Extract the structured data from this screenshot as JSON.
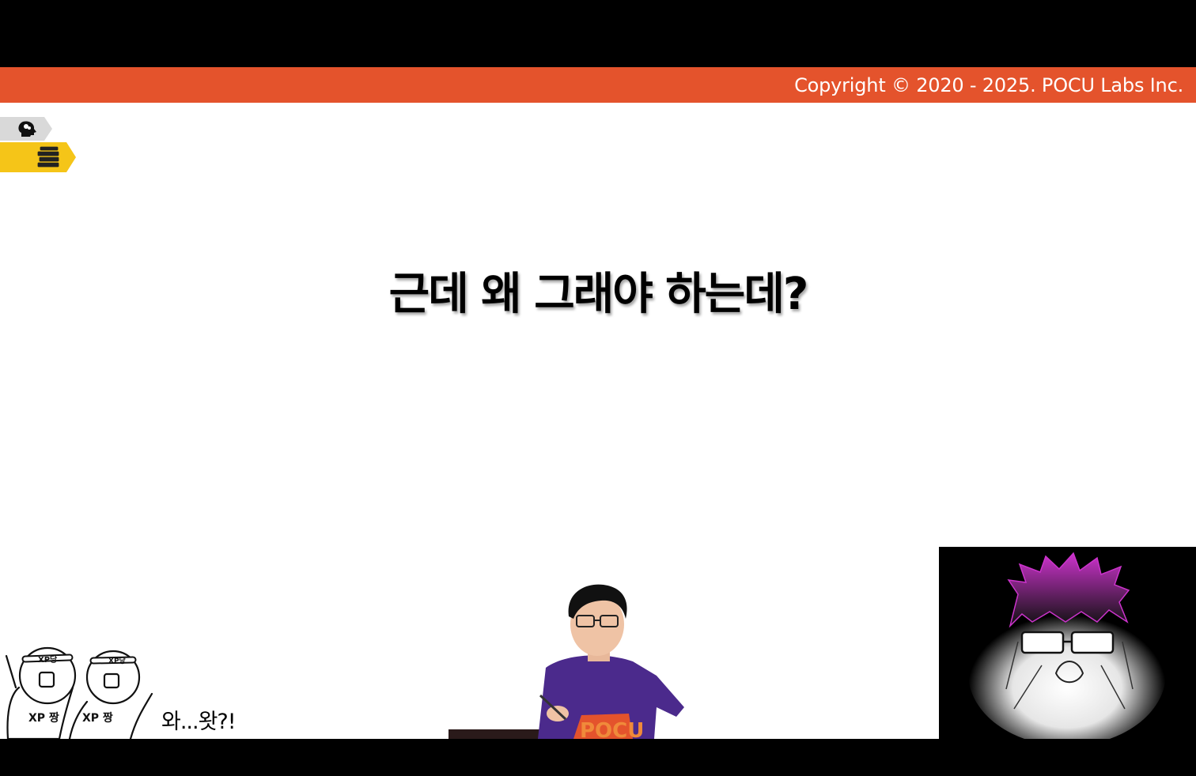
{
  "banner": {
    "copyright": "Copyright © 2020 - 2025. POCU Labs Inc.",
    "color": "#e4532c"
  },
  "side_tags": [
    {
      "icon": "brain-head-icon",
      "color": "#d9d9d9"
    },
    {
      "icon": "book-stack-icon",
      "color": "#f5c518"
    }
  ],
  "slide": {
    "title": "근데 왜 그래야 하는데?"
  },
  "cartoon": {
    "headband_label_1": "XP당",
    "headband_label_2": "XP당",
    "shirt_label_1": "XP 짱",
    "shirt_label_2": "XP 짱",
    "caption": "와...왓?!"
  },
  "presenter": {
    "shirt_text": "POCU",
    "shirt_color": "#4b2a8c"
  },
  "pip": {
    "hair_color": "#cc33cc"
  }
}
